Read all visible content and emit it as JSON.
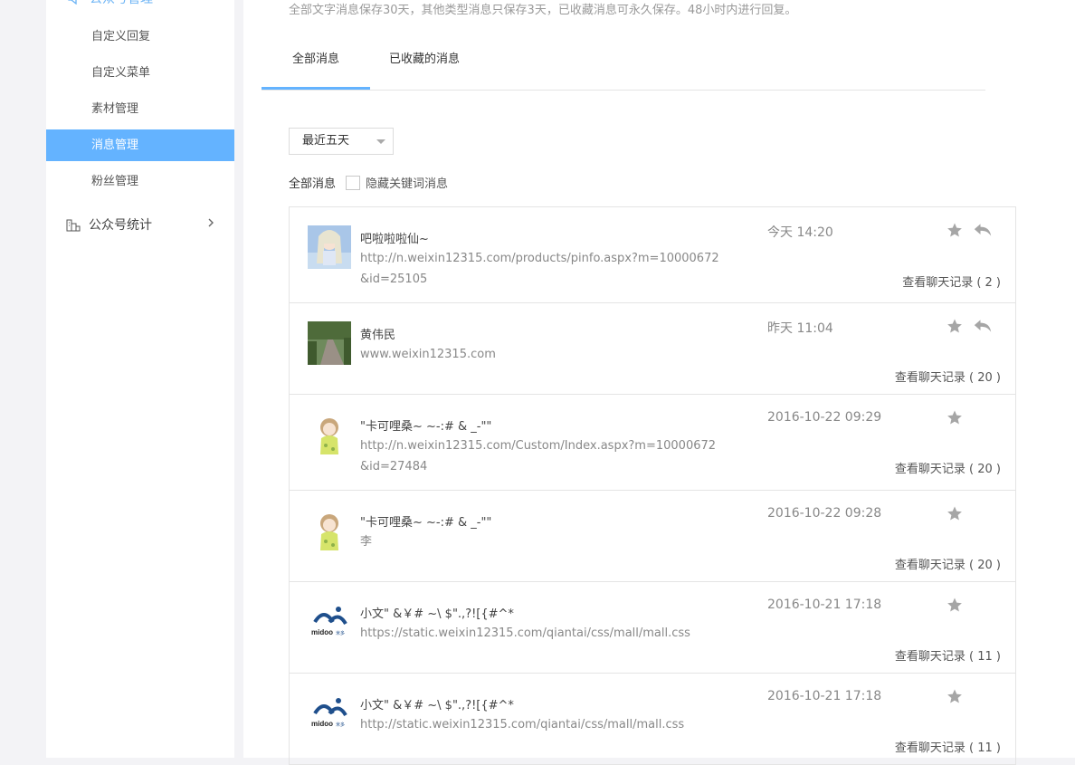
{
  "sidebar": {
    "group_title": "公众号管理",
    "items": [
      {
        "label": "自定义回复"
      },
      {
        "label": "自定义菜单"
      },
      {
        "label": "素材管理"
      },
      {
        "label": "消息管理"
      },
      {
        "label": "粉丝管理"
      }
    ],
    "stats_label": "公众号统计",
    "accent": "#64b3ff"
  },
  "main": {
    "notice": "全部文字消息保存30天，其他类型消息只保存3天，已收藏消息可永久保存。48小时内进行回复。",
    "tabs": [
      {
        "label": "全部消息"
      },
      {
        "label": "已收藏的消息"
      }
    ],
    "period_select": "最近五天",
    "filter_label": "全部消息",
    "hide_keyword_label": "隐藏关键词消息",
    "messages": [
      {
        "name": "吧啦啦啦仙~",
        "content": "http://n.weixin12315.com/products/pinfo.aspx?m=10000672&id=25105",
        "time": "今天 14:20",
        "history": "查看聊天记录 ( 2 )"
      },
      {
        "name": "黄伟民",
        "content": "www.weixin12315.com",
        "time": "昨天 11:04",
        "history": "查看聊天记录 ( 20 )"
      },
      {
        "name": "\"卡可哩桑~ ~-:# & _-\"\"",
        "content": "http://n.weixin12315.com/Custom/Index.aspx?m=10000672&id=27484",
        "time": "2016-10-22 09:29",
        "history": "查看聊天记录 ( 20 )"
      },
      {
        "name": "\"卡可哩桑~ ~-:# & _-\"\"",
        "content": "李",
        "time": "2016-10-22 09:28",
        "history": "查看聊天记录 ( 20 )"
      },
      {
        "name": "小文\" &￥# ~\\ $\".,?![{#^*",
        "content": "https://static.weixin12315.com/qiantai/css/mall/mall.css",
        "time": "2016-10-21 17:18",
        "history": "查看聊天记录 ( 11 )"
      },
      {
        "name": "小文\" &￥# ~\\ $\".,?![{#^*",
        "content": "http://static.weixin12315.com/qiantai/css/mall/mall.css",
        "time": "2016-10-21 17:18",
        "history": "查看聊天记录 ( 11 )"
      }
    ],
    "midoo_logo_text": "midoo米多"
  }
}
